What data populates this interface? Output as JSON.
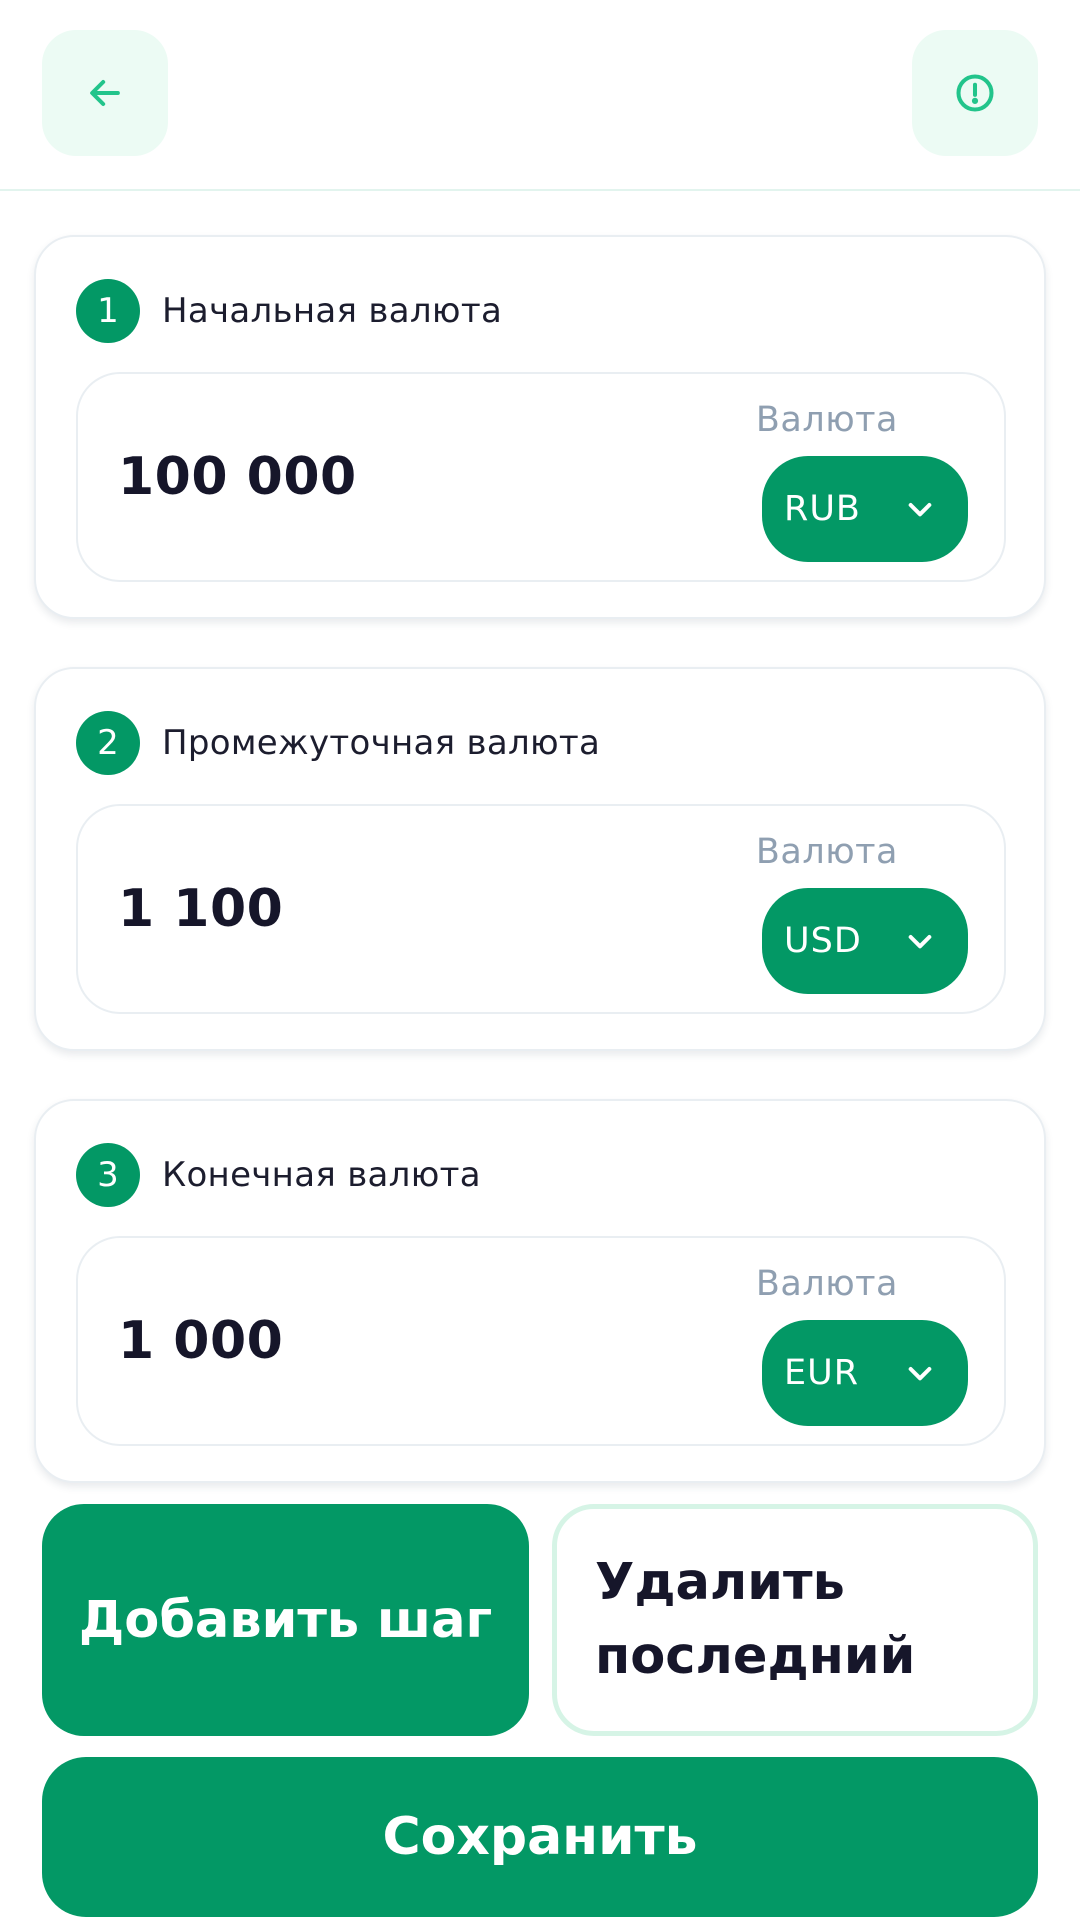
{
  "header": {
    "back_icon": "arrow-left-icon",
    "info_icon": "alert-circle-icon"
  },
  "steps": [
    {
      "number": "1",
      "title": "Начальная валюта",
      "amount": "100 000",
      "currency_label": "Валюта",
      "currency": "RUB"
    },
    {
      "number": "2",
      "title": "Промежуточная валюта",
      "amount": "1 100",
      "currency_label": "Валюта",
      "currency": "USD"
    },
    {
      "number": "3",
      "title": "Конечная валюта",
      "amount": "1 000",
      "currency_label": "Валюта",
      "currency": "EUR"
    }
  ],
  "actions": {
    "add_step": "Добавить шаг",
    "remove_last": "Удалить последний",
    "save": "Сохранить"
  },
  "colors": {
    "accent": "#039865",
    "icon_bg": "#ecfbf4",
    "icon": "#22c48b"
  }
}
